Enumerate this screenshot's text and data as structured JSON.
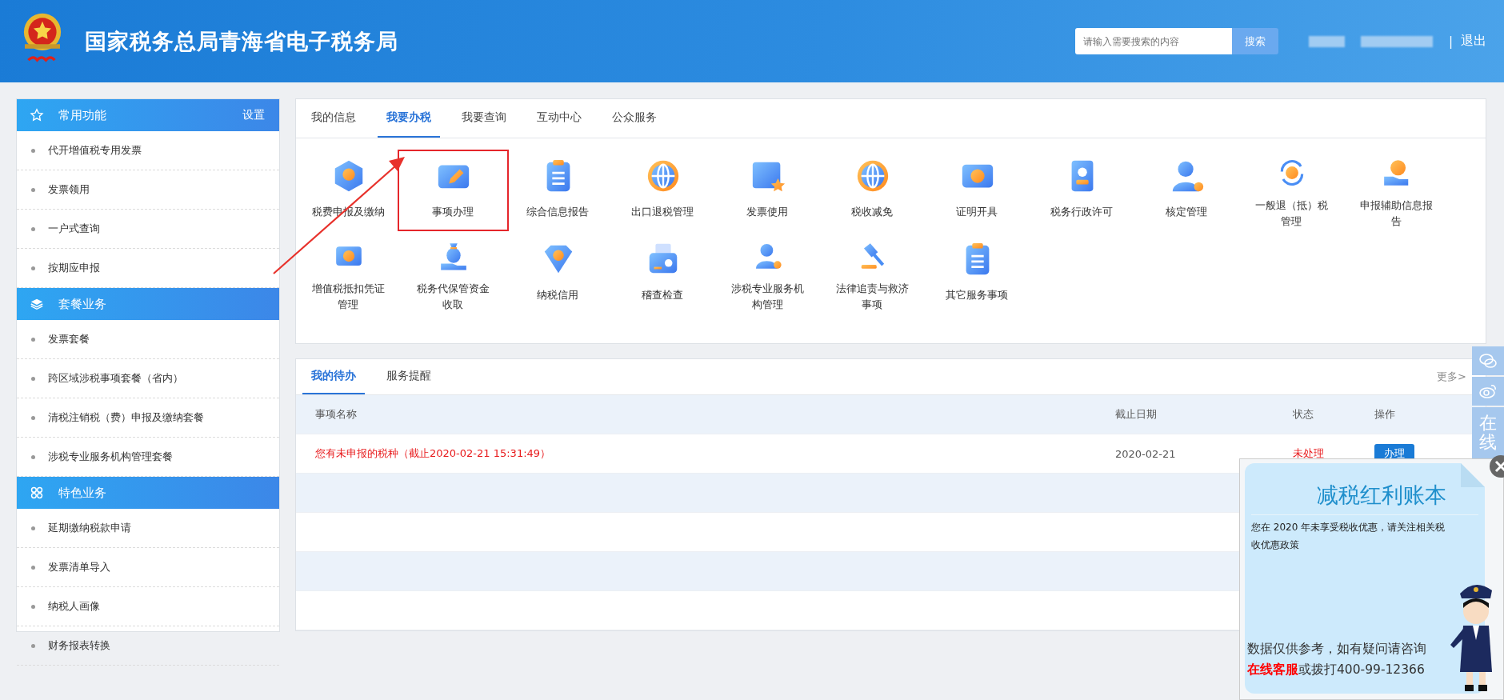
{
  "header": {
    "title": "国家税务总局青海省电子税务局",
    "search": {
      "placeholder": "请输入需要搜索的内容",
      "button": "搜索"
    },
    "separator": "|",
    "logout": "退出"
  },
  "sidebar": {
    "sections": [
      {
        "title": "常用功能",
        "action": "设置",
        "items": [
          "代开增值税专用发票",
          "发票领用",
          "一户式查询",
          "按期应申报"
        ]
      },
      {
        "title": "套餐业务",
        "items": [
          "发票套餐",
          "跨区域涉税事项套餐（省内）",
          "清税注销税（费）申报及缴纳套餐",
          "涉税专业服务机构管理套餐"
        ]
      },
      {
        "title": "特色业务",
        "items": [
          "延期缴纳税款申请",
          "发票清单导入",
          "纳税人画像",
          "财务报表转换"
        ]
      }
    ]
  },
  "service_tabs": [
    {
      "label": "我的信息",
      "selected": false
    },
    {
      "label": "我要办税",
      "selected": true
    },
    {
      "label": "我要查询",
      "selected": false
    },
    {
      "label": "互动中心",
      "selected": false
    },
    {
      "label": "公众服务",
      "selected": false
    }
  ],
  "services": [
    {
      "label": "税费申报及缴纳",
      "highlighted": false
    },
    {
      "label": "事项办理",
      "highlighted": true
    },
    {
      "label": "综合信息报告",
      "highlighted": false
    },
    {
      "label": "出口退税管理",
      "highlighted": false
    },
    {
      "label": "发票使用",
      "highlighted": false
    },
    {
      "label": "税收减免",
      "highlighted": false
    },
    {
      "label": "证明开具",
      "highlighted": false
    },
    {
      "label": "税务行政许可",
      "highlighted": false
    },
    {
      "label": "核定管理",
      "highlighted": false
    },
    {
      "label": "一般退（抵）税管理",
      "highlighted": false
    },
    {
      "label": "申报辅助信息报告",
      "highlighted": false
    },
    {
      "label": "增值税抵扣凭证管理",
      "highlighted": false
    },
    {
      "label": "税务代保管资金收取",
      "highlighted": false
    },
    {
      "label": "纳税信用",
      "highlighted": false
    },
    {
      "label": "稽查检查",
      "highlighted": false
    },
    {
      "label": "涉税专业服务机构管理",
      "highlighted": false
    },
    {
      "label": "法律追责与救济事项",
      "highlighted": false
    },
    {
      "label": "其它服务事项",
      "highlighted": false
    }
  ],
  "todo": {
    "tabs": [
      {
        "label": "我的待办",
        "selected": true
      },
      {
        "label": "服务提醒",
        "selected": false
      }
    ],
    "more": "更多>",
    "columns": [
      "事项名称",
      "截止日期",
      "状态",
      "操作"
    ],
    "rows": [
      {
        "name": "您有未申报的税种（截止2020-02-21 15:31:49）",
        "deadline": "2020-02-21",
        "status": "未处理",
        "action": "办理"
      }
    ]
  },
  "side_bar": {
    "label": "在线"
  },
  "popup": {
    "title": "减税红利账本",
    "message": "您在 2020 年未享受税收优惠，请关注相关税收优惠政策",
    "footer": "数据仅供参考，如有疑问请咨询",
    "contact": "**在线客服**或拨打400-99-12366"
  }
}
